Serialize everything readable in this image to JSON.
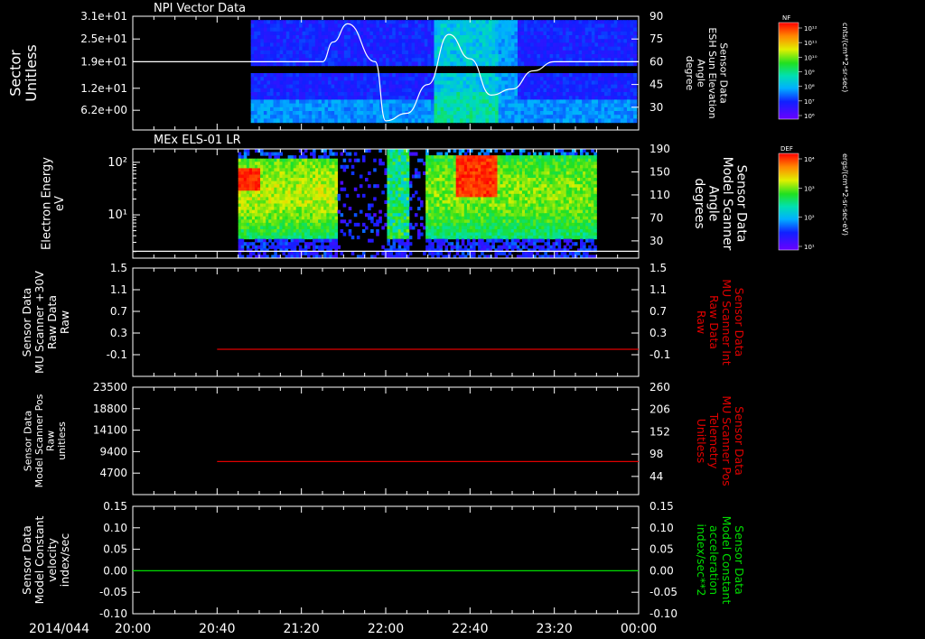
{
  "time_axis": {
    "date_label": "2014/044",
    "range": [
      "20:00",
      "00:00"
    ],
    "tick_labels": [
      "20:00",
      "20:40",
      "21:20",
      "22:00",
      "22:40",
      "23:20",
      "00:00"
    ]
  },
  "colors": {
    "background": "#000000",
    "axes": "#ffffff",
    "left_series_line": "#ffffff",
    "red_series": "#e00000",
    "green_series": "#00dd00"
  },
  "chart_data": [
    {
      "type": "heatmap",
      "title": "NPI Vector Data",
      "ylabel_lines": [
        "Sector",
        "Unitless"
      ],
      "y_tick_labels": [
        "3.1e+01",
        "2.5e+01",
        "1.9e+01",
        "1.2e+01",
        "6.2e+00"
      ],
      "y_tick_values": [
        31,
        25,
        19,
        12,
        6.2
      ],
      "ylim": [
        1,
        31
      ],
      "right_axis_label_lines": [
        "Sensor Data",
        "ESH Sun Elevation",
        "Angle",
        "degree"
      ],
      "right_y_tick_labels": [
        "90",
        "75",
        "60",
        "45",
        "30"
      ],
      "right_y_tick_values": [
        90,
        75,
        60,
        45,
        30
      ],
      "right_ylim": [
        15,
        90
      ],
      "colorbar": {
        "title": "NF",
        "units": "cnts/(cm**2-sr-sec)",
        "tick_labels": [
          "10¹²",
          "10¹¹",
          "10¹⁰",
          "10⁹",
          "10⁸",
          "10⁷",
          "10⁶"
        ]
      },
      "line_series": {
        "axis": "right",
        "x": [
          "20:00",
          "20:55",
          "21:30",
          "21:35",
          "21:42",
          "21:55",
          "22:00",
          "22:10",
          "22:20",
          "22:30",
          "22:40",
          "22:50",
          "23:00",
          "23:10",
          "23:20",
          "00:00"
        ],
        "values": [
          60,
          60,
          60,
          73,
          85,
          60,
          21,
          26,
          45,
          78,
          62,
          38,
          42,
          54,
          60,
          60
        ]
      }
    },
    {
      "type": "heatmap",
      "title": "MEx ELS-01 LR",
      "ylabel_lines": [
        "Electron Energy",
        "eV"
      ],
      "y_scale": "log",
      "y_tick_labels": [
        "10²",
        "10¹"
      ],
      "y_tick_values": [
        100,
        10
      ],
      "ylim": [
        1.5,
        180
      ],
      "right_axis_label_lines": [
        "Sensor Data",
        "Model Scanner",
        "Angle",
        "degrees"
      ],
      "right_y_tick_labels": [
        "190",
        "150",
        "110",
        "70",
        "30"
      ],
      "right_y_tick_values": [
        190,
        150,
        110,
        70,
        30
      ],
      "right_ylim": [
        0,
        190
      ],
      "colorbar": {
        "title": "DEF",
        "units": "ergs/(cm**2-sr-sec-eV)",
        "tick_labels": [
          "10⁴",
          "10³",
          "10²",
          "10¹"
        ]
      },
      "line_series": {
        "axis": "right",
        "x": [
          "20:00",
          "00:00"
        ],
        "values": [
          12,
          12
        ]
      }
    },
    {
      "type": "line",
      "ylabel_lines": [
        "Sensor Data",
        "MU Scanner +30V",
        "Raw Data",
        "Raw"
      ],
      "y_tick_labels": [
        "1.5",
        "1.1",
        "0.7",
        "0.3",
        "-0.1"
      ],
      "y_tick_values": [
        1.5,
        1.1,
        0.7,
        0.3,
        -0.1
      ],
      "ylim": [
        -0.5,
        1.5
      ],
      "right_axis_label_lines": [
        "Sensor Data",
        "MU Scanner Int",
        "Raw Data",
        "Raw"
      ],
      "right_y_tick_labels": [
        "1.5",
        "1.1",
        "0.7",
        "0.3",
        "-0.1"
      ],
      "right_y_tick_values": [
        1.5,
        1.1,
        0.7,
        0.3,
        -0.1
      ],
      "right_ylim": [
        -0.5,
        1.5
      ],
      "series": [
        {
          "axis": "right",
          "color": "#e00000",
          "x": [
            "20:40",
            "00:00"
          ],
          "values": [
            0.0,
            0.0
          ]
        }
      ]
    },
    {
      "type": "line",
      "ylabel_lines": [
        "Sensor Data",
        "Model Scanner Pos",
        "Raw",
        "unitless"
      ],
      "y_tick_labels": [
        "23500",
        "18800",
        "14100",
        "9400",
        "4700"
      ],
      "y_tick_values": [
        23500,
        18800,
        14100,
        9400,
        4700
      ],
      "ylim": [
        0,
        23500
      ],
      "right_axis_label_lines": [
        "Sensor Data",
        "MU Scanner Pos",
        "Telemetry",
        "Unitless"
      ],
      "right_y_tick_labels": [
        "260",
        "206",
        "152",
        "98",
        "44"
      ],
      "right_y_tick_values": [
        260,
        206,
        152,
        98,
        44
      ],
      "right_ylim": [
        0,
        260
      ],
      "series": [
        {
          "axis": "right",
          "color": "#e00000",
          "x": [
            "20:40",
            "00:00"
          ],
          "values": [
            80,
            80
          ]
        }
      ]
    },
    {
      "type": "line",
      "ylabel_lines": [
        "Sensor Data",
        "Model Constant",
        "velocity",
        "index/sec"
      ],
      "y_tick_labels": [
        "0.15",
        "0.10",
        "0.05",
        "0.00",
        "-0.05",
        "-0.10"
      ],
      "y_tick_values": [
        0.15,
        0.1,
        0.05,
        0.0,
        -0.05,
        -0.1
      ],
      "ylim": [
        -0.1,
        0.15
      ],
      "right_axis_label_lines": [
        "Sensor Data",
        "Model Constant",
        "acceleration",
        "index/sec**2"
      ],
      "right_y_tick_labels": [
        "0.15",
        "0.10",
        "0.05",
        "0.00",
        "-0.05",
        "-0.10"
      ],
      "right_y_tick_values": [
        0.15,
        0.1,
        0.05,
        0.0,
        -0.05,
        -0.1
      ],
      "right_ylim": [
        -0.1,
        0.15
      ],
      "series": [
        {
          "axis": "left",
          "color": "#00dd00",
          "x": [
            "20:00",
            "00:00"
          ],
          "values": [
            0.0,
            0.0
          ]
        }
      ]
    }
  ]
}
